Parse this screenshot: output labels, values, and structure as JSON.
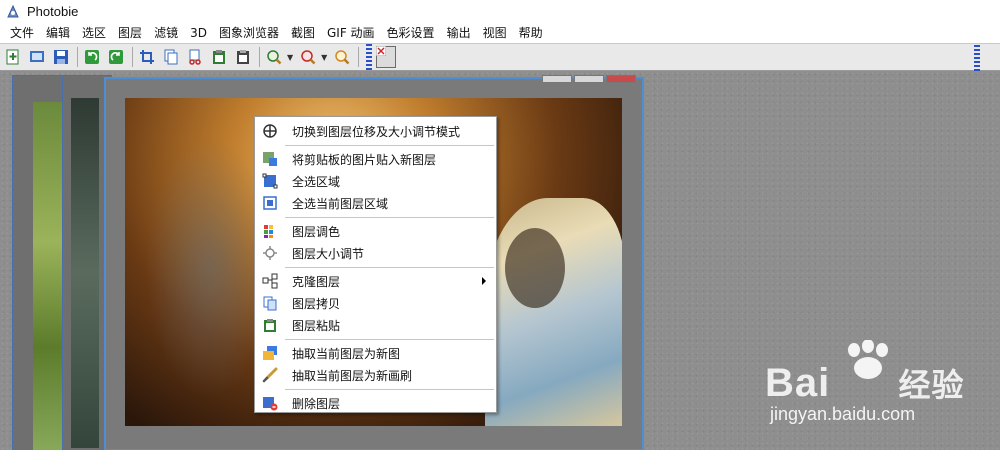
{
  "window": {
    "title": "Photobie",
    "icon": "photobie-app-icon"
  },
  "menubar": {
    "items": [
      "文件",
      "编辑",
      "选区",
      "图层",
      "滤镜",
      "3D",
      "图象浏览器",
      "截图",
      "GIF 动画",
      "色彩设置",
      "输出",
      "视图",
      "帮助"
    ]
  },
  "toolbar": {
    "icons": [
      "new-file-icon",
      "open-file-icon",
      "save-icon",
      "undo-icon",
      "redo-icon",
      "crop-icon",
      "copy-icon",
      "cut-icon",
      "paste-icon",
      "paste-new-icon",
      "zoom-in-icon",
      "zoom-out-icon",
      "zoom-fit-icon"
    ]
  },
  "context_menu": {
    "items": [
      {
        "label": "切换到图层位移及大小调节模式",
        "icon": "move-mode-icon"
      },
      {
        "label": "将剪贴板的图片贴入新图层",
        "icon": "paste-layer-icon"
      },
      {
        "label": "全选区域",
        "icon": "select-all-icon"
      },
      {
        "label": "全选当前图层区域",
        "icon": "select-layer-icon"
      },
      {
        "label": "图层调色",
        "icon": "palette-icon"
      },
      {
        "label": "图层大小调节",
        "icon": "resize-icon"
      },
      {
        "label": "克隆图层",
        "icon": "clone-icon",
        "submenu": true
      },
      {
        "label": "图层拷贝",
        "icon": "copy-layer-icon"
      },
      {
        "label": "图层粘贴",
        "icon": "paste-icon"
      },
      {
        "label": "抽取当前图层为新图",
        "icon": "extract-image-icon"
      },
      {
        "label": "抽取当前图层为新画刷",
        "icon": "brush-icon"
      },
      {
        "label": "删除图层",
        "icon": "delete-layer-icon"
      }
    ]
  },
  "watermark": {
    "brand": "Bai",
    "brand_suffix": "经验",
    "url": "jingyan.baidu.com"
  },
  "colors": {
    "accent_blue": "#2850c8",
    "menu_bg": "#ffffff",
    "workspace": "#8e8e8e"
  }
}
